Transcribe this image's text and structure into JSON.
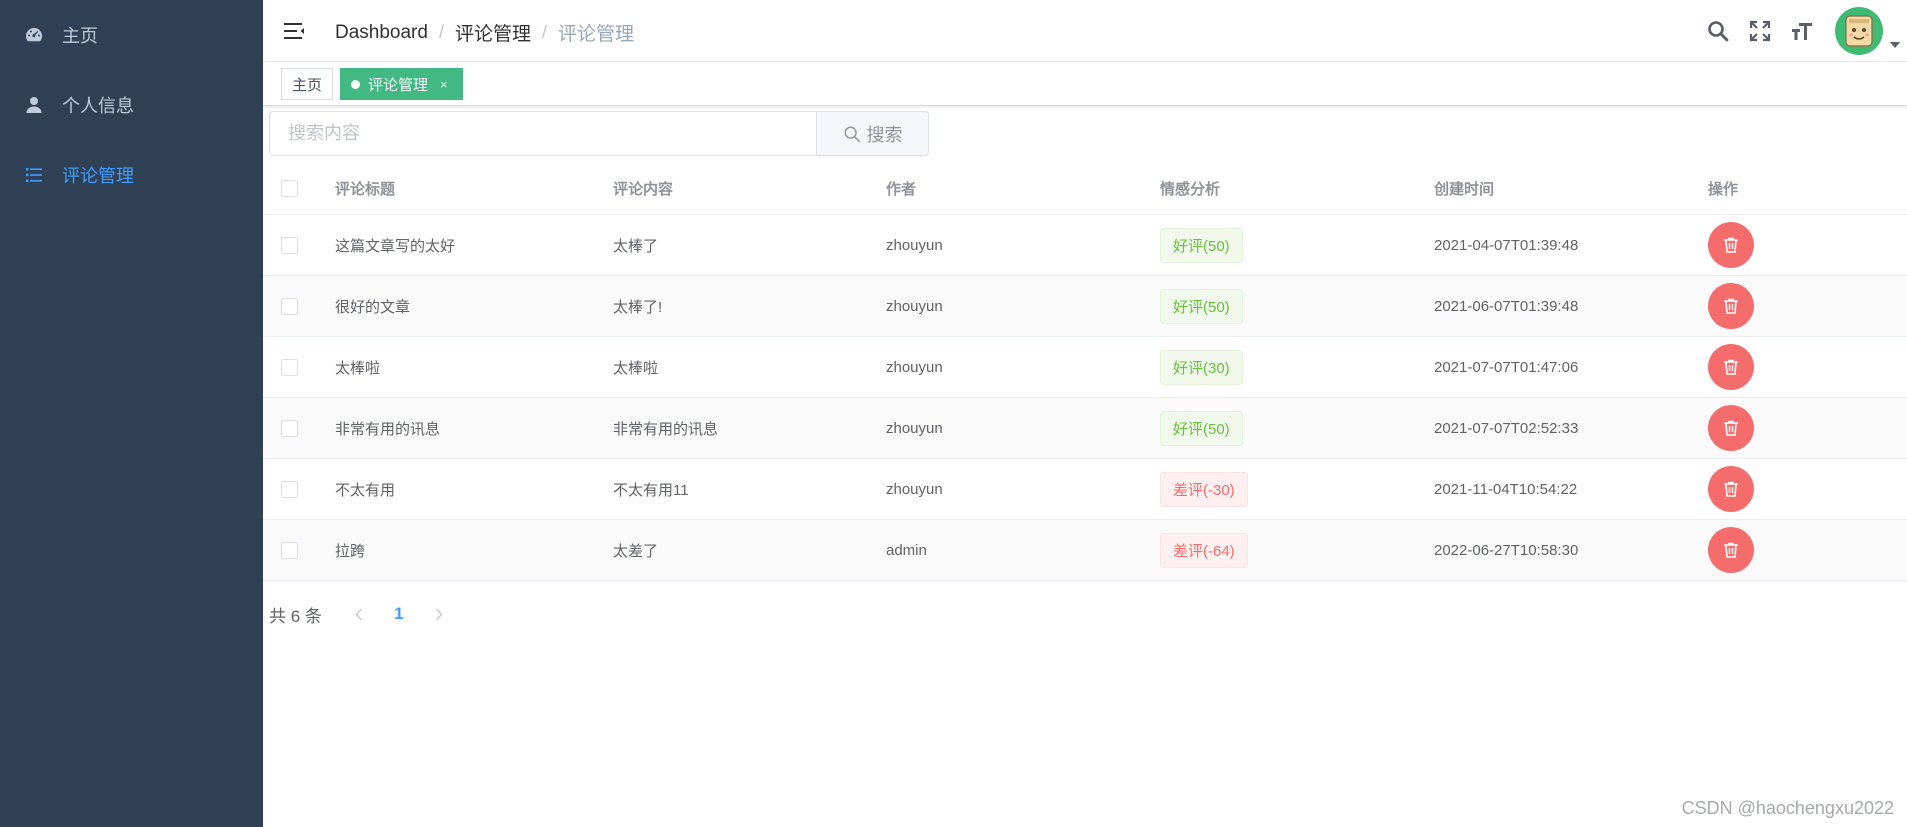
{
  "sidebar": {
    "items": [
      {
        "label": "主页",
        "icon": "dashboard-icon"
      },
      {
        "label": "个人信息",
        "icon": "user-icon"
      },
      {
        "label": "评论管理",
        "icon": "list-icon",
        "active": true
      }
    ]
  },
  "navbar": {
    "breadcrumb": [
      "Dashboard",
      "评论管理",
      "评论管理"
    ]
  },
  "tags": {
    "home_label": "主页",
    "active_label": "评论管理",
    "close_glyph": "×"
  },
  "search": {
    "placeholder": "搜索内容",
    "button_label": "搜索"
  },
  "table": {
    "headers": [
      "评论标题",
      "评论内容",
      "作者",
      "情感分析",
      "创建时间",
      "操作"
    ],
    "rows": [
      {
        "title": "这篇文章写的太好",
        "content": "太棒了",
        "author": "zhouyun",
        "sentiment": "好评(50)",
        "sentiment_type": "good",
        "created": "2021-04-07T01:39:48"
      },
      {
        "title": "很好的文章",
        "content": "太棒了!",
        "author": "zhouyun",
        "sentiment": "好评(50)",
        "sentiment_type": "good",
        "created": "2021-06-07T01:39:48"
      },
      {
        "title": "太棒啦",
        "content": "太棒啦",
        "author": "zhouyun",
        "sentiment": "好评(30)",
        "sentiment_type": "good",
        "created": "2021-07-07T01:47:06"
      },
      {
        "title": "非常有用的讯息",
        "content": "非常有用的讯息",
        "author": "zhouyun",
        "sentiment": "好评(50)",
        "sentiment_type": "good",
        "created": "2021-07-07T02:52:33"
      },
      {
        "title": "不太有用",
        "content": "不太有用11",
        "author": "zhouyun",
        "sentiment": "差评(-30)",
        "sentiment_type": "bad",
        "created": "2021-11-04T10:54:22"
      },
      {
        "title": "拉跨",
        "content": "太差了",
        "author": "admin",
        "sentiment": "差评(-64)",
        "sentiment_type": "bad",
        "created": "2022-06-27T10:58:30"
      }
    ]
  },
  "pagination": {
    "total_label": "共 6 条",
    "current_page": "1"
  },
  "watermark": "CSDN @haochengxu2022",
  "colors": {
    "sidebar_bg": "#304156",
    "active": "#409eff",
    "tag_active": "#42b983",
    "danger": "#f56c6c",
    "success": "#67c23a"
  }
}
